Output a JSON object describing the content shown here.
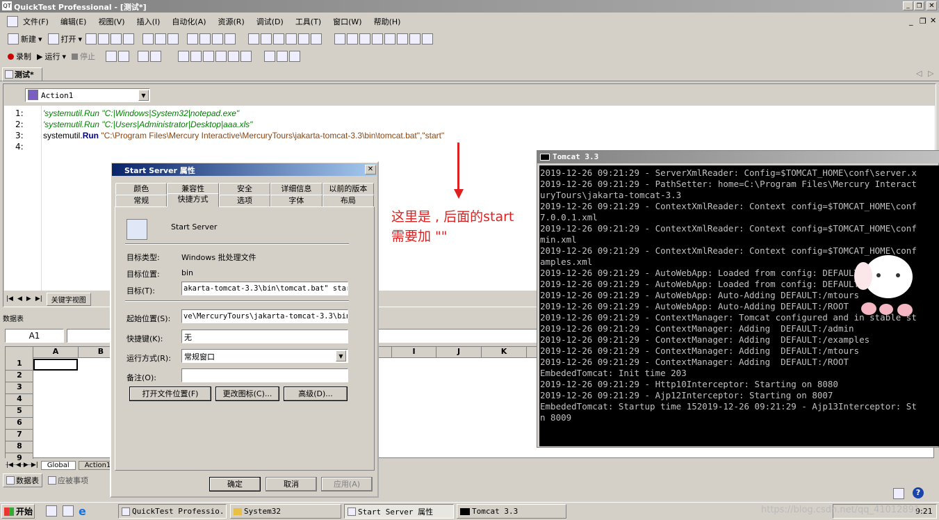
{
  "window": {
    "title": "QuickTest Professional - [测试*]"
  },
  "menu": [
    "文件(F)",
    "编辑(E)",
    "视图(V)",
    "插入(I)",
    "自动化(A)",
    "资源(R)",
    "调试(D)",
    "工具(T)",
    "窗口(W)",
    "帮助(H)"
  ],
  "toolbar1": {
    "new": "新建",
    "open": "打开"
  },
  "toolbar2": {
    "record": "录制",
    "run": "运行",
    "stop": "停止"
  },
  "doc_tab": "测试*",
  "action_select": "Action1",
  "code_lines": [
    {
      "num": "1:",
      "text": "'systemutil.Run \"C:|Windows|System32|notepad.exe\""
    },
    {
      "num": "2:",
      "text": "'systemutil.Run \"C:|Users|Administrator|Desktop|aaa.xls\""
    },
    {
      "num": "3:",
      "p1": "systemutil.",
      "p2": "Run",
      "p3": " \"C:\\Program Files\\Mercury Interactive\\MercuryTours\\jakarta-tomcat-3.3\\bin\\tomcat.bat\",\"start\""
    },
    {
      "num": "4:",
      "text": ""
    }
  ],
  "keyword_view_tab": "关键字视图",
  "datatable": {
    "title": "数据表",
    "cell_ref": "A1",
    "columns": [
      "A",
      "B",
      "I",
      "J",
      "K"
    ],
    "rows": [
      "1",
      "2",
      "3",
      "4",
      "5",
      "6",
      "7",
      "8",
      "9"
    ],
    "sheet_tabs": [
      "Global",
      "Action1"
    ]
  },
  "bottom_tabs": [
    "数据表",
    "应被事项"
  ],
  "dialog": {
    "title": "Start Server 属性",
    "tabs_row1": [
      "颜色",
      "兼容性",
      "安全",
      "详细信息",
      "以前的版本"
    ],
    "tabs_row2": [
      "常规",
      "快捷方式",
      "选项",
      "字体",
      "布局"
    ],
    "name": "Start Server",
    "target_type_label": "目标类型:",
    "target_type": "Windows 批处理文件",
    "target_loc_label": "目标位置:",
    "target_loc": "bin",
    "target_label": "目标(T):",
    "target": "akarta-tomcat-3.3\\bin\\tomcat.bat\" start",
    "start_in_label": "起始位置(S):",
    "start_in": "ve\\MercuryTours\\jakarta-tomcat-3.3\\bin\"",
    "hotkey_label": "快捷键(K):",
    "hotkey": "无",
    "run_label": "运行方式(R):",
    "run": "常规窗口",
    "comment_label": "备注(O):",
    "comment": "",
    "btn_open_loc": "打开文件位置(F)",
    "btn_change_icon": "更改图标(C)...",
    "btn_advanced": "高级(D)...",
    "btn_ok": "确定",
    "btn_cancel": "取消",
    "btn_apply": "应用(A)"
  },
  "annotation": {
    "line1": "这里是 , 后面的start",
    "line2": "需要加 \"\""
  },
  "console": {
    "title": "Tomcat 3.3",
    "lines": [
      "2019-12-26 09:21:29 - ServerXmlReader: Config=$TOMCAT_HOME\\conf\\server.x",
      "2019-12-26 09:21:29 - PathSetter: home=C:\\Program Files\\Mercury Interact",
      "uryTours\\jakarta-tomcat-3.3",
      "2019-12-26 09:21:29 - ContextXmlReader: Context config=$TOMCAT_HOME\\conf",
      "7.0.0.1.xml",
      "2019-12-26 09:21:29 - ContextXmlReader: Context config=$TOMCAT_HOME\\conf",
      "min.xml",
      "2019-12-26 09:21:29 - ContextXmlReader: Context config=$TOMCAT_HOME\\conf",
      "amples.xml",
      "2019-12-26 09:21:29 - AutoWebApp: Loaded from config: DEFAULT:/admin",
      "2019-12-26 09:21:29 - AutoWebApp: Loaded from config: DEFAULT:/examples",
      "2019-12-26 09:21:29 - AutoWebApp: Auto-Adding DEFAULT:/mtours",
      "2019-12-26 09:21:29 - AutoWebApp: Auto-Adding DEFAULT:/ROOT",
      "2019-12-26 09:21:29 - ContextManager: Tomcat configured and in stable st",
      "2019-12-26 09:21:29 - ContextManager: Adding  DEFAULT:/admin",
      "2019-12-26 09:21:29 - ContextManager: Adding  DEFAULT:/examples",
      "2019-12-26 09:21:29 - ContextManager: Adding  DEFAULT:/mtours",
      "2019-12-26 09:21:29 - ContextManager: Adding  DEFAULT:/ROOT",
      "EmbededTomcat: Init time 203",
      "2019-12-26 09:21:29 - Http10Interceptor: Starting on 8080",
      "2019-12-26 09:21:29 - Ajp12Interceptor: Starting on 8007",
      "EmbededTomcat: Startup time 152019-12-26 09:21:29 - Ajp13Interceptor: St",
      "n 8009"
    ]
  },
  "taskbar": {
    "start": "开始",
    "items": [
      "QuickTest Professio...",
      "System32",
      "Start Server 属性",
      "Tomcat 3.3"
    ],
    "clock": "9:21"
  },
  "watermark": "https://blog.csdn.net/qq_41012891",
  "colors": {
    "comment": "#008000",
    "keyword": "#00008b",
    "annotation": "#e02020",
    "console_bg": "#000000",
    "console_fg": "#c0c0c0",
    "title_active": "#0a246a"
  }
}
